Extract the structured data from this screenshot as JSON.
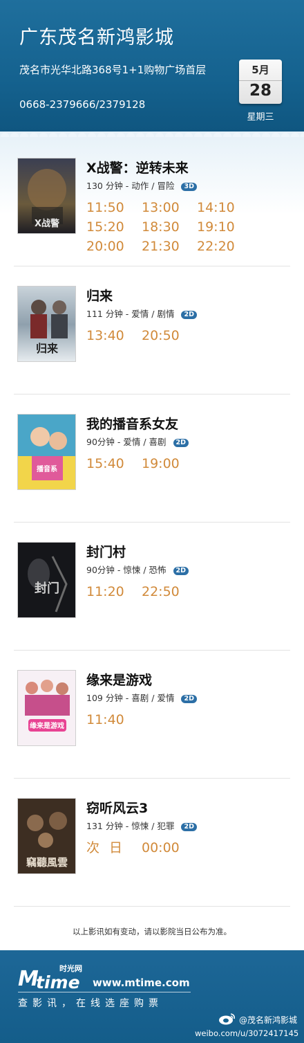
{
  "header": {
    "cinema_name": "广东茂名新鸿影城",
    "address": "茂名市光华北路368号1+1购物广场首层",
    "phone": "0668-2379666/2379128",
    "month": "5月",
    "day": "28",
    "weekday": "星期三"
  },
  "movies": [
    {
      "title": "X战警：逆转未来",
      "meta": "130 分钟 - 动作 / 冒险",
      "format": "3D",
      "times": [
        "11:50",
        "13:00",
        "14:10",
        "15:20",
        "18:30",
        "19:10",
        "20:00",
        "21:30",
        "22:20"
      ]
    },
    {
      "title": "归来",
      "meta": "111 分钟 - 爱情 / 剧情",
      "format": "2D",
      "times": [
        "13:40",
        "20:50"
      ]
    },
    {
      "title": "我的播音系女友",
      "meta": "90分钟 - 爱情 / 喜剧",
      "format": "2D",
      "times": [
        "15:40",
        "19:00"
      ]
    },
    {
      "title": "封门村",
      "meta": "90分钟 - 惊悚 / 恐怖",
      "format": "2D",
      "times": [
        "11:20",
        "22:50"
      ]
    },
    {
      "title": "缘来是游戏",
      "meta": "109 分钟 - 喜剧 / 爱情",
      "format": "2D",
      "times": [
        "11:40"
      ]
    },
    {
      "title": "窃听风云3",
      "meta": "131 分钟 - 惊悚 / 犯罪",
      "format": "2D",
      "times": [
        "次 日",
        "00:00"
      ]
    }
  ],
  "notice": "以上影讯如有变动，请以影院当日公布为准。",
  "footer": {
    "logo_m": "M",
    "logo_time": "time",
    "logo_cn": "时光网",
    "url": "www.mtime.com",
    "slogan": "查影讯，在线选座购票",
    "weibo_name": "@茂名新鸿影城",
    "weibo_url": "weibo.com/u/3072417145"
  },
  "colors": {
    "header_blue": "#15628f",
    "showtime_orange": "#d18a3a",
    "badge_blue": "#2c6fa6"
  }
}
